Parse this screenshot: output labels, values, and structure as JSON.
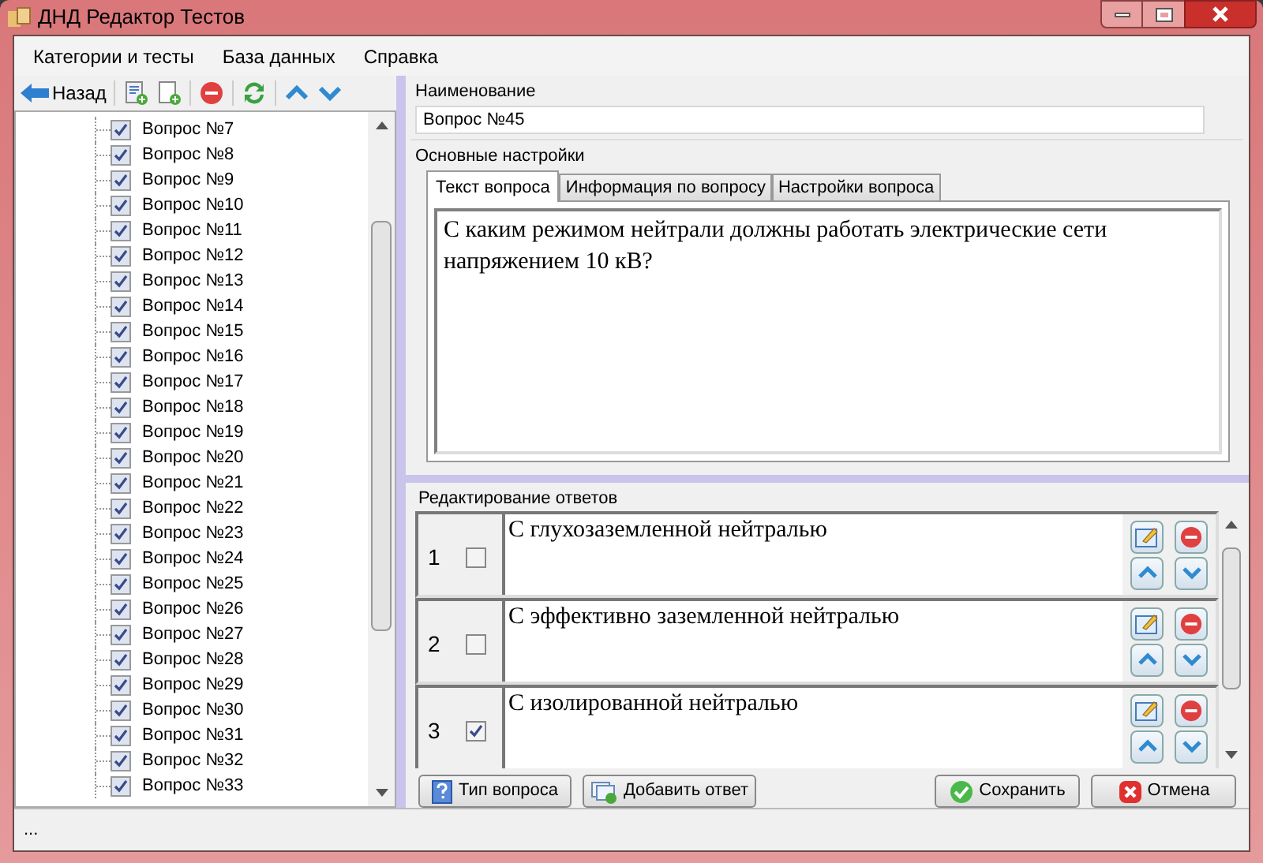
{
  "window": {
    "title": "ДНД Редактор Тестов"
  },
  "menu": [
    "Категории и тесты",
    "База данных",
    "Справка"
  ],
  "toolbar": {
    "back_label": "Назад"
  },
  "tree": {
    "items": [
      {
        "label": "Вопрос №7",
        "checked": true
      },
      {
        "label": "Вопрос №8",
        "checked": true
      },
      {
        "label": "Вопрос №9",
        "checked": true
      },
      {
        "label": "Вопрос №10",
        "checked": true
      },
      {
        "label": "Вопрос №11",
        "checked": true
      },
      {
        "label": "Вопрос №12",
        "checked": true
      },
      {
        "label": "Вопрос №13",
        "checked": true
      },
      {
        "label": "Вопрос №14",
        "checked": true
      },
      {
        "label": "Вопрос №15",
        "checked": true
      },
      {
        "label": "Вопрос №16",
        "checked": true
      },
      {
        "label": "Вопрос №17",
        "checked": true
      },
      {
        "label": "Вопрос №18",
        "checked": true
      },
      {
        "label": "Вопрос №19",
        "checked": true
      },
      {
        "label": "Вопрос №20",
        "checked": true
      },
      {
        "label": "Вопрос №21",
        "checked": true
      },
      {
        "label": "Вопрос №22",
        "checked": true
      },
      {
        "label": "Вопрос №23",
        "checked": true
      },
      {
        "label": "Вопрос №24",
        "checked": true
      },
      {
        "label": "Вопрос №25",
        "checked": true
      },
      {
        "label": "Вопрос №26",
        "checked": true
      },
      {
        "label": "Вопрос №27",
        "checked": true
      },
      {
        "label": "Вопрос №28",
        "checked": true
      },
      {
        "label": "Вопрос №29",
        "checked": true
      },
      {
        "label": "Вопрос №30",
        "checked": true
      },
      {
        "label": "Вопрос №31",
        "checked": true
      },
      {
        "label": "Вопрос №32",
        "checked": true
      },
      {
        "label": "Вопрос №33",
        "checked": true
      }
    ]
  },
  "name_label": "Наименование",
  "name_value": "Вопрос №45",
  "settings_label": "Основные настройки",
  "tabs": [
    {
      "label": "Текст вопроса",
      "selected": true
    },
    {
      "label": "Информация по вопросу",
      "selected": false
    },
    {
      "label": "Настройки вопроса",
      "selected": false
    }
  ],
  "question_text": "С каким режимом нейтрали должны работать электрические сети напряжением 10 кВ?",
  "answers_label": "Редактирование ответов",
  "answers": [
    {
      "number": "1",
      "checked": false,
      "text": "С глухозаземленной нейтралью"
    },
    {
      "number": "2",
      "checked": false,
      "text": "С эффективно заземленной нейтралью"
    },
    {
      "number": "3",
      "checked": true,
      "text": "С изолированной нейтралью"
    }
  ],
  "buttons": [
    {
      "kind": "type",
      "label": "Тип вопроса"
    },
    {
      "kind": "add",
      "label": "Добавить ответ"
    },
    {
      "kind": "save",
      "label": "Сохранить"
    },
    {
      "kind": "cancel",
      "label": "Отмена"
    }
  ],
  "status_bar": "..."
}
